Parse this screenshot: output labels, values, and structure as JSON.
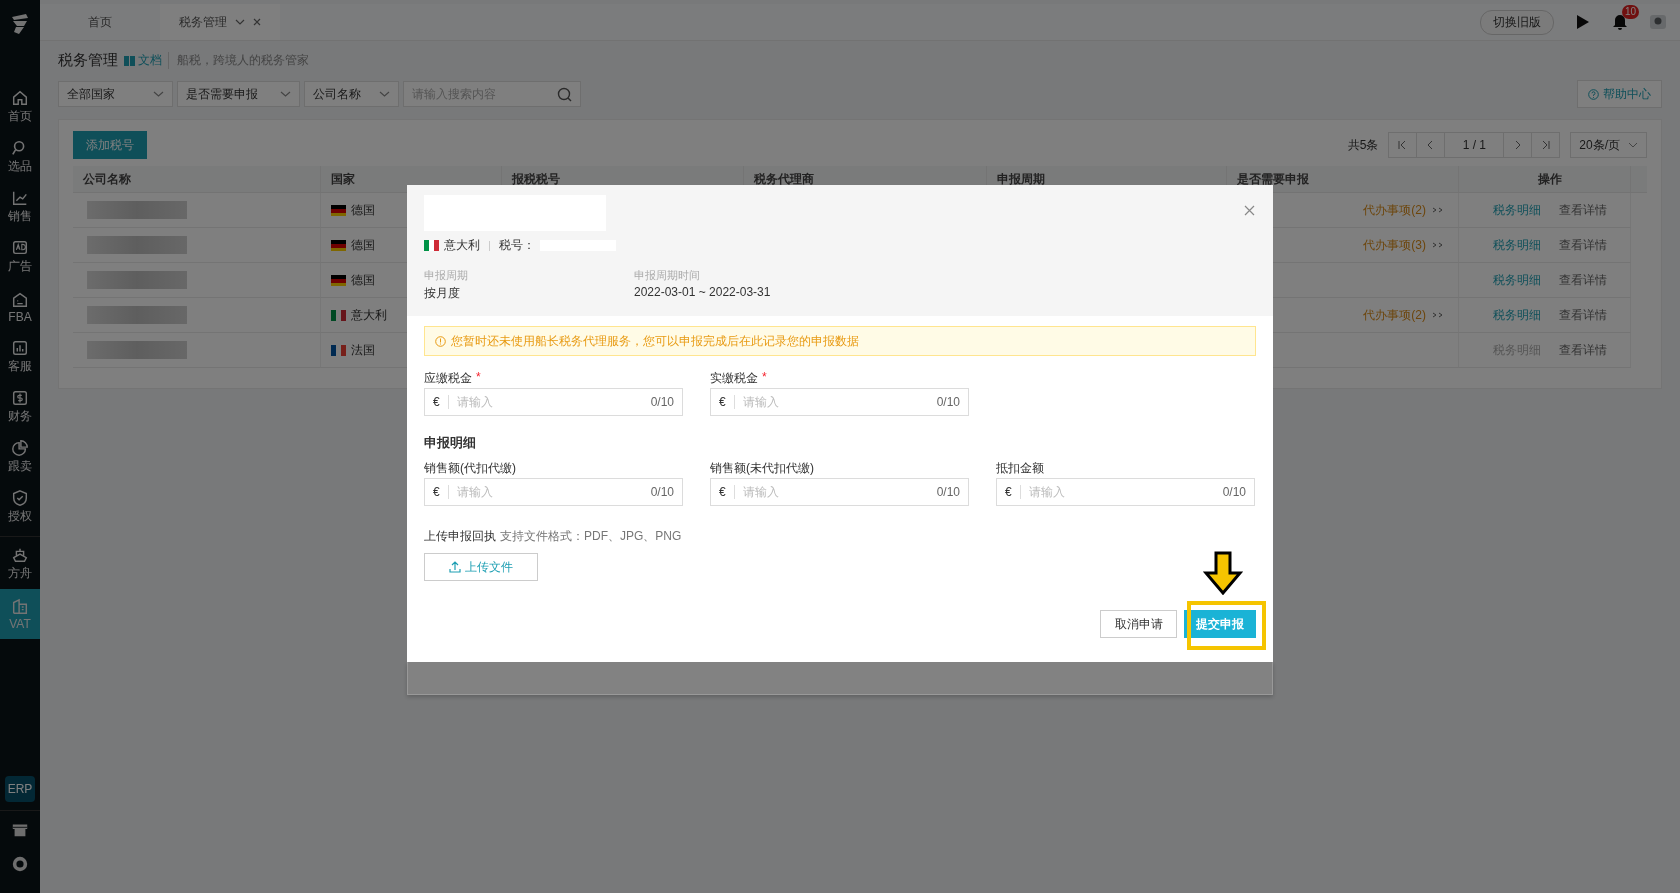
{
  "tabs": [
    {
      "label": "首页",
      "selected": false
    },
    {
      "label": "税务管理",
      "selected": true
    }
  ],
  "topbar": {
    "switch_version": "切换旧版",
    "notification_count": "10"
  },
  "sidebar": {
    "items": [
      {
        "label": "首页",
        "selected": false
      },
      {
        "label": "选品",
        "selected": false
      },
      {
        "label": "销售",
        "selected": false
      },
      {
        "label": "广告",
        "selected": false
      },
      {
        "label": "FBA",
        "selected": false
      },
      {
        "label": "客服",
        "selected": false
      },
      {
        "label": "财务",
        "selected": false
      },
      {
        "label": "跟卖",
        "selected": false
      },
      {
        "label": "授权",
        "selected": false
      },
      {
        "label": "方舟",
        "selected": false
      },
      {
        "label": "VAT",
        "selected": true
      }
    ],
    "erp": "ERP"
  },
  "page": {
    "title": "税务管理",
    "doc_link": "文档",
    "subtitle": "船税，跨境人的税务管家",
    "filters": [
      {
        "value": "全部国家"
      },
      {
        "value": "是否需要申报"
      },
      {
        "value": "公司名称"
      }
    ],
    "search": {
      "placeholder": "请输入搜索内容"
    },
    "help": "帮助中心",
    "add_button": "添加税号",
    "total": "共5条",
    "page_indicator": "1 / 1",
    "page_size": "20条/页"
  },
  "table": {
    "columns": [
      "公司名称",
      "国家",
      "报税税号",
      "税务代理商",
      "申报周期",
      "是否需要申报",
      "操作"
    ],
    "rows": [
      {
        "kind": "de",
        "country": "德国",
        "todo": "代办事项(2)",
        "actions": [
          {
            "label": "税务明细",
            "disabled": false
          },
          {
            "label": "查看详情",
            "disabled": false
          }
        ]
      },
      {
        "kind": "de",
        "country": "德国",
        "todo": "代办事项(3)",
        "actions": [
          {
            "label": "税务明细",
            "disabled": false
          },
          {
            "label": "查看详情",
            "disabled": false
          }
        ]
      },
      {
        "kind": "de",
        "country": "德国",
        "actions": [
          {
            "label": "税务明细",
            "disabled": false
          },
          {
            "label": "查看详情",
            "disabled": false
          }
        ]
      },
      {
        "kind": "it",
        "country": "意大利",
        "todo": "代办事项(2)",
        "actions": [
          {
            "label": "税务明细",
            "disabled": false
          },
          {
            "label": "查看详情",
            "disabled": false
          }
        ]
      },
      {
        "kind": "fr",
        "country": "法国",
        "actions": [
          {
            "label": "税务明细",
            "disabled": true
          },
          {
            "label": "查看详情",
            "disabled": false
          }
        ]
      }
    ]
  },
  "modal": {
    "kind": "it",
    "country": "意大利",
    "tax_no_label": "税号：",
    "period_label": "申报周期",
    "period": "按月度",
    "period_time_label": "申报周期时间",
    "period_time": "2022-03-01 ~ 2022-03-31",
    "notice": "您暂时还未使用船长税务代理服务，您可以申报完成后在此记录您的申报数据",
    "fields": [
      {
        "label": "应缴税金",
        "required_mark": "*",
        "currency": "€",
        "placeholder": "请输入",
        "counter": "0/10"
      },
      {
        "label": "实缴税金",
        "required_mark": "*",
        "currency": "€",
        "placeholder": "请输入",
        "counter": "0/10"
      }
    ],
    "detail_title": "申报明细",
    "detail_fields": [
      {
        "label": "销售额(代扣代缴)",
        "currency": "€",
        "placeholder": "请输入",
        "counter": "0/10"
      },
      {
        "label": "销售额(未代扣代缴)",
        "currency": "€",
        "placeholder": "请输入",
        "counter": "0/10"
      },
      {
        "label": "抵扣金额",
        "currency": "€",
        "placeholder": "请输入",
        "counter": "0/10"
      }
    ],
    "upload_label": "上传申报回执",
    "upload_hint": "支持文件格式：PDF、JPG、PNG",
    "upload_button": "上传文件",
    "buttons": {
      "cancel": "取消申请",
      "submit": "提交申报"
    }
  }
}
